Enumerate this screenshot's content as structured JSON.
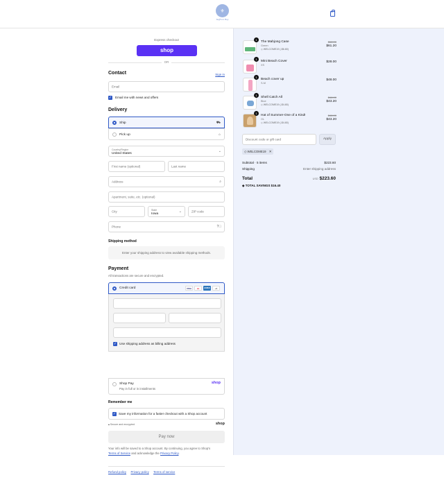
{
  "store": {
    "logo_text": "Saffron Bay"
  },
  "express": {
    "label": "Express checkout",
    "shop_button": "shop",
    "or": "OR"
  },
  "contact": {
    "title": "Contact",
    "sign_in": "Sign in",
    "email_placeholder": "Email",
    "news_label": "Email me with news and offers"
  },
  "delivery": {
    "title": "Delivery",
    "options": [
      {
        "label": "Ship",
        "selected": true
      },
      {
        "label": "Pick up",
        "selected": false
      }
    ],
    "country_label": "Country/Region",
    "country_value": "United States",
    "first_name_placeholder": "First name (optional)",
    "last_name_placeholder": "Last name",
    "address_placeholder": "Address",
    "apartment_placeholder": "Apartment, suite, etc. (optional)",
    "city_placeholder": "City",
    "state_label": "State",
    "state_value": "Iowa",
    "zip_placeholder": "ZIP code",
    "phone_placeholder": "Phone"
  },
  "shipping_method": {
    "title": "Shipping method",
    "message": "Enter your shipping address to view available shipping methods."
  },
  "payment": {
    "title": "Payment",
    "subtitle": "All transactions are secure and encrypted.",
    "credit_card_label": "Credit card",
    "card_brands": [
      "VISA",
      "MC",
      "AMEX",
      "+3"
    ],
    "billing_label": "Use shipping address as billing address",
    "shop_pay_label": "Shop Pay",
    "shop_pay_sub": "Pay in full or in installments",
    "shop_pay_logo": "shop"
  },
  "remember": {
    "title": "Remember me",
    "save_label": "Save my information for a faster checkout with a Shop account",
    "secure_label": "Secure and encrypted",
    "shop_logo": "shop"
  },
  "pay_now": "Pay now",
  "legal": {
    "line1": "Your info will be saved to a Shop account. By continuing, you agree to Shop's",
    "terms": "Terms of Service",
    "and": "and acknowledge the",
    "privacy": "Privacy Policy",
    "period": "."
  },
  "footer_links": [
    "Refund policy",
    "Privacy policy",
    "Terms of service"
  ],
  "cart": {
    "items": [
      {
        "name": "The Mahjong Case",
        "variant": "Green",
        "discount": "WELCOME19 (-$6.80)",
        "old_price": "$68.00",
        "price": "$61.20",
        "qty": "1",
        "thumb_color": "#5fb67a"
      },
      {
        "name": "Mini Beach Cover",
        "variant": "XS",
        "discount": "",
        "old_price": "",
        "price": "$28.00",
        "qty": "1",
        "thumb_color": "#f08db0"
      },
      {
        "name": "Beach cover up",
        "variant": "S-M",
        "discount": "",
        "old_price": "",
        "price": "$48.00",
        "qty": "1",
        "thumb_color": "#f3a6c3"
      },
      {
        "name": "Shell Catch All",
        "variant": "Blue",
        "discount": "WELCOME19 (-$4.80)",
        "old_price": "$48.00",
        "price": "$43.20",
        "qty": "1",
        "thumb_color": "#7aa7d6"
      },
      {
        "name": "Hat of Summer-One of a Kind!",
        "variant": "OL",
        "discount": "WELCOME19 (-$4.80)",
        "old_price": "$48.00",
        "price": "$43.20",
        "qty": "1",
        "thumb_color": "#c9a06b"
      }
    ],
    "discount_placeholder": "Discount code or gift card",
    "apply": "Apply",
    "applied_code": "WELCOME19",
    "subtotal_label": "Subtotal · 5 items",
    "subtotal_value": "$223.60",
    "shipping_label": "Shipping",
    "shipping_value": "Enter shipping address",
    "total_label": "Total",
    "currency": "USD",
    "total_value": "$223.60",
    "savings_label": "TOTAL SAVINGS",
    "savings_value": "$16.40"
  }
}
